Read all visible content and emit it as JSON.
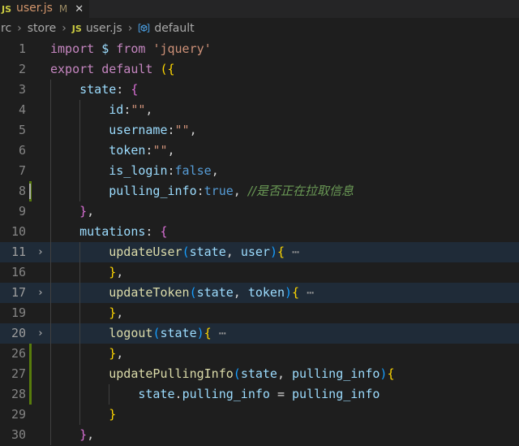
{
  "window": {
    "theme": "Dark+ (default dark)",
    "background": "#1e1e1e"
  },
  "tabbar": {
    "tabs": [
      {
        "icon": "js-file-icon",
        "icon_label": "JS",
        "label": "user.js",
        "dirty_badge": "M",
        "close_label": "✕",
        "active": true
      }
    ]
  },
  "breadcrumb": {
    "items": [
      {
        "label": "rc",
        "icon": null
      },
      {
        "label": "store",
        "icon": null
      },
      {
        "label": "user.js",
        "icon": "js-file-icon",
        "icon_label": "JS"
      },
      {
        "label": "default",
        "icon": "namespace-symbol-icon"
      }
    ],
    "separator": "›"
  },
  "editor": {
    "language": "javascript",
    "fold_placeholder": "⋯",
    "lines": [
      {
        "number": "1",
        "changed": false,
        "folded": false,
        "guides": 0,
        "tokens": [
          {
            "t": "import",
            "c": "kw"
          },
          {
            "t": " ",
            "c": "plain"
          },
          {
            "t": "$",
            "c": "var"
          },
          {
            "t": " ",
            "c": "plain"
          },
          {
            "t": "from",
            "c": "kw"
          },
          {
            "t": " ",
            "c": "plain"
          },
          {
            "t": "'jquery'",
            "c": "str"
          }
        ]
      },
      {
        "number": "2",
        "changed": false,
        "folded": false,
        "guides": 0,
        "tokens": [
          {
            "t": "export",
            "c": "kw"
          },
          {
            "t": " ",
            "c": "plain"
          },
          {
            "t": "default",
            "c": "kw"
          },
          {
            "t": " ",
            "c": "plain"
          },
          {
            "t": "(",
            "c": "p1"
          },
          {
            "t": "{",
            "c": "p1"
          }
        ]
      },
      {
        "number": "3",
        "changed": false,
        "folded": false,
        "guides": 1,
        "tokens": [
          {
            "t": "    ",
            "c": "plain"
          },
          {
            "t": "state",
            "c": "var"
          },
          {
            "t": ":",
            "c": "op"
          },
          {
            "t": " ",
            "c": "plain"
          },
          {
            "t": "{",
            "c": "p2"
          }
        ]
      },
      {
        "number": "4",
        "changed": false,
        "folded": false,
        "guides": 2,
        "tokens": [
          {
            "t": "        ",
            "c": "plain"
          },
          {
            "t": "id",
            "c": "var"
          },
          {
            "t": ":",
            "c": "op"
          },
          {
            "t": "\"\"",
            "c": "str"
          },
          {
            "t": ",",
            "c": "op"
          }
        ]
      },
      {
        "number": "5",
        "changed": false,
        "folded": false,
        "guides": 2,
        "tokens": [
          {
            "t": "        ",
            "c": "plain"
          },
          {
            "t": "username",
            "c": "var"
          },
          {
            "t": ":",
            "c": "op"
          },
          {
            "t": "\"\"",
            "c": "str"
          },
          {
            "t": ",",
            "c": "op"
          }
        ]
      },
      {
        "number": "6",
        "changed": false,
        "folded": false,
        "guides": 2,
        "tokens": [
          {
            "t": "        ",
            "c": "plain"
          },
          {
            "t": "token",
            "c": "var"
          },
          {
            "t": ":",
            "c": "op"
          },
          {
            "t": "\"\"",
            "c": "str"
          },
          {
            "t": ",",
            "c": "op"
          }
        ]
      },
      {
        "number": "7",
        "changed": false,
        "folded": false,
        "guides": 2,
        "tokens": [
          {
            "t": "        ",
            "c": "plain"
          },
          {
            "t": "is_login",
            "c": "var"
          },
          {
            "t": ":",
            "c": "op"
          },
          {
            "t": "false",
            "c": "num"
          },
          {
            "t": ",",
            "c": "op"
          }
        ]
      },
      {
        "number": "8",
        "changed": true,
        "folded": false,
        "guides": 2,
        "caret": true,
        "tokens": [
          {
            "t": "        ",
            "c": "plain"
          },
          {
            "t": "pulling_info",
            "c": "var"
          },
          {
            "t": ":",
            "c": "op"
          },
          {
            "t": "true",
            "c": "num"
          },
          {
            "t": ", ",
            "c": "op"
          },
          {
            "t": "//是否正在拉取信息",
            "c": "cmt"
          }
        ]
      },
      {
        "number": "9",
        "changed": false,
        "folded": false,
        "guides": 1,
        "tokens": [
          {
            "t": "    ",
            "c": "plain"
          },
          {
            "t": "}",
            "c": "p2"
          },
          {
            "t": ",",
            "c": "op"
          }
        ]
      },
      {
        "number": "10",
        "changed": false,
        "folded": false,
        "guides": 1,
        "tokens": [
          {
            "t": "    ",
            "c": "plain"
          },
          {
            "t": "mutations",
            "c": "var"
          },
          {
            "t": ":",
            "c": "op"
          },
          {
            "t": " ",
            "c": "plain"
          },
          {
            "t": "{",
            "c": "p2"
          }
        ]
      },
      {
        "number": "11",
        "changed": false,
        "folded": true,
        "guides": 2,
        "tokens": [
          {
            "t": "        ",
            "c": "plain"
          },
          {
            "t": "updateUser",
            "c": "fn"
          },
          {
            "t": "(",
            "c": "p3"
          },
          {
            "t": "state",
            "c": "var"
          },
          {
            "t": ",",
            "c": "op"
          },
          {
            "t": " ",
            "c": "plain"
          },
          {
            "t": "user",
            "c": "var"
          },
          {
            "t": ")",
            "c": "p3"
          },
          {
            "t": "{",
            "c": "p1"
          },
          {
            "t": " ⋯",
            "c": "dots"
          }
        ]
      },
      {
        "number": "16",
        "changed": false,
        "folded": false,
        "guides": 2,
        "tokens": [
          {
            "t": "        ",
            "c": "plain"
          },
          {
            "t": "}",
            "c": "p1"
          },
          {
            "t": ",",
            "c": "op"
          }
        ]
      },
      {
        "number": "17",
        "changed": false,
        "folded": true,
        "guides": 2,
        "tokens": [
          {
            "t": "        ",
            "c": "plain"
          },
          {
            "t": "updateToken",
            "c": "fn"
          },
          {
            "t": "(",
            "c": "p3"
          },
          {
            "t": "state",
            "c": "var"
          },
          {
            "t": ",",
            "c": "op"
          },
          {
            "t": " ",
            "c": "plain"
          },
          {
            "t": "token",
            "c": "var"
          },
          {
            "t": ")",
            "c": "p3"
          },
          {
            "t": "{",
            "c": "p1"
          },
          {
            "t": " ⋯",
            "c": "dots"
          }
        ]
      },
      {
        "number": "19",
        "changed": false,
        "folded": false,
        "guides": 2,
        "tokens": [
          {
            "t": "        ",
            "c": "plain"
          },
          {
            "t": "}",
            "c": "p1"
          },
          {
            "t": ",",
            "c": "op"
          }
        ]
      },
      {
        "number": "20",
        "changed": false,
        "folded": true,
        "guides": 2,
        "tokens": [
          {
            "t": "        ",
            "c": "plain"
          },
          {
            "t": "logout",
            "c": "fn"
          },
          {
            "t": "(",
            "c": "p3"
          },
          {
            "t": "state",
            "c": "var"
          },
          {
            "t": ")",
            "c": "p3"
          },
          {
            "t": "{",
            "c": "p1"
          },
          {
            "t": " ⋯",
            "c": "dots"
          }
        ]
      },
      {
        "number": "26",
        "changed": true,
        "folded": false,
        "guides": 2,
        "tokens": [
          {
            "t": "        ",
            "c": "plain"
          },
          {
            "t": "}",
            "c": "p1"
          },
          {
            "t": ",",
            "c": "op"
          }
        ]
      },
      {
        "number": "27",
        "changed": true,
        "folded": false,
        "guides": 2,
        "tokens": [
          {
            "t": "        ",
            "c": "plain"
          },
          {
            "t": "updatePullingInfo",
            "c": "fn"
          },
          {
            "t": "(",
            "c": "p3"
          },
          {
            "t": "state",
            "c": "var"
          },
          {
            "t": ",",
            "c": "op"
          },
          {
            "t": " ",
            "c": "plain"
          },
          {
            "t": "pulling_info",
            "c": "var"
          },
          {
            "t": ")",
            "c": "p3"
          },
          {
            "t": "{",
            "c": "p1"
          }
        ]
      },
      {
        "number": "28",
        "changed": true,
        "folded": false,
        "guides": 3,
        "tokens": [
          {
            "t": "            ",
            "c": "plain"
          },
          {
            "t": "state",
            "c": "var"
          },
          {
            "t": ".",
            "c": "op"
          },
          {
            "t": "pulling_info",
            "c": "var"
          },
          {
            "t": " ",
            "c": "plain"
          },
          {
            "t": "=",
            "c": "op"
          },
          {
            "t": " ",
            "c": "plain"
          },
          {
            "t": "pulling_info",
            "c": "var"
          }
        ]
      },
      {
        "number": "29",
        "changed": false,
        "folded": false,
        "guides": 2,
        "tokens": [
          {
            "t": "        ",
            "c": "plain"
          },
          {
            "t": "}",
            "c": "p1"
          }
        ]
      },
      {
        "number": "30",
        "changed": false,
        "folded": false,
        "guides": 1,
        "tokens": [
          {
            "t": "    ",
            "c": "plain"
          },
          {
            "t": "}",
            "c": "p2"
          },
          {
            "t": ",",
            "c": "op"
          }
        ]
      }
    ]
  }
}
